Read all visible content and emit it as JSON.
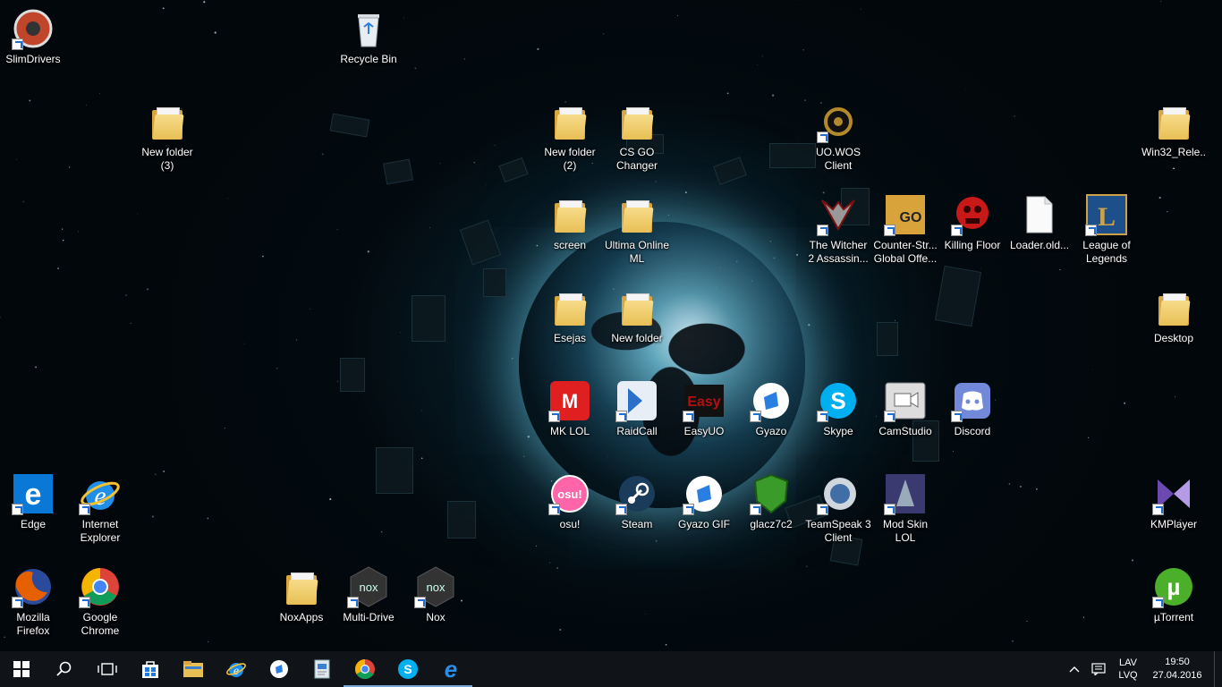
{
  "desktop": {
    "icons": [
      {
        "id": "slimdrivers",
        "label": "SlimDrivers",
        "type": "app",
        "color": "#c0452a",
        "shortcut": true
      },
      {
        "id": "recycle-bin",
        "label": "Recycle Bin",
        "type": "recycle",
        "shortcut": false
      },
      {
        "id": "new-folder-3",
        "label": "New folder (3)",
        "type": "folder",
        "shortcut": false
      },
      {
        "id": "new-folder-2",
        "label": "New folder (2)",
        "type": "folder",
        "shortcut": false
      },
      {
        "id": "cs-go-changer",
        "label": "CS GO Changer",
        "type": "folder",
        "shortcut": false
      },
      {
        "id": "uo-wos-client",
        "label": "UO.WOS Client",
        "type": "app",
        "color": "#b38a2a",
        "shortcut": true
      },
      {
        "id": "win32-release",
        "label": "Win32_Rele...",
        "type": "folder",
        "shortcut": false
      },
      {
        "id": "screen",
        "label": "screen",
        "type": "folder",
        "shortcut": false
      },
      {
        "id": "ultima-online-ml",
        "label": "Ultima Online ML",
        "type": "folder",
        "shortcut": false
      },
      {
        "id": "witcher-2",
        "label": "The Witcher 2 Assassin...",
        "type": "app",
        "color": "#7a1010",
        "shortcut": true
      },
      {
        "id": "counter-strike",
        "label": "Counter-Str... Global Offe...",
        "type": "app",
        "color": "#d7a33a",
        "shortcut": true
      },
      {
        "id": "killing-floor",
        "label": "Killing Floor",
        "type": "app",
        "color": "#c81818",
        "shortcut": true
      },
      {
        "id": "loader-old",
        "label": "Loader.old...",
        "type": "file",
        "shortcut": false
      },
      {
        "id": "league-of-legends",
        "label": "League of Legends",
        "type": "app",
        "color": "#1d4f8a",
        "shortcut": true
      },
      {
        "id": "esejas",
        "label": "Esejas",
        "type": "folder",
        "shortcut": false
      },
      {
        "id": "new-folder",
        "label": "New folder",
        "type": "folder",
        "shortcut": false
      },
      {
        "id": "desktop-folder",
        "label": "Desktop",
        "type": "folder",
        "shortcut": false
      },
      {
        "id": "mk-lol",
        "label": "MK LOL",
        "type": "app",
        "color": "#e02020",
        "shortcut": true
      },
      {
        "id": "raidcall",
        "label": "RaidCall",
        "type": "app",
        "color": "#2a6fc8",
        "shortcut": true
      },
      {
        "id": "easyuo",
        "label": "EasyUO",
        "type": "app",
        "color": "#b01010",
        "shortcut": true
      },
      {
        "id": "gyazo",
        "label": "Gyazo",
        "type": "app",
        "color": "#2a7de1",
        "shortcut": true
      },
      {
        "id": "skype",
        "label": "Skype",
        "type": "app",
        "color": "#00aff0",
        "shortcut": true
      },
      {
        "id": "camstudio",
        "label": "CamStudio",
        "type": "app",
        "color": "#888888",
        "shortcut": true
      },
      {
        "id": "discord",
        "label": "Discord",
        "type": "app",
        "color": "#7289da",
        "shortcut": true
      },
      {
        "id": "edge",
        "label": "Edge",
        "type": "app",
        "color": "#0a78d7",
        "shortcut": true
      },
      {
        "id": "internet-explorer",
        "label": "Internet Explorer",
        "type": "app",
        "color": "#1e8ee8",
        "shortcut": true
      },
      {
        "id": "osu",
        "label": "osu!",
        "type": "app",
        "color": "#ff66aa",
        "shortcut": true
      },
      {
        "id": "steam",
        "label": "Steam",
        "type": "app",
        "color": "#1b3b5a",
        "shortcut": true
      },
      {
        "id": "gyazo-gif",
        "label": "Gyazo GIF",
        "type": "app",
        "color": "#2a7de1",
        "shortcut": true
      },
      {
        "id": "glacz7c2",
        "label": "glacz7c2",
        "type": "app",
        "color": "#3a9a2a",
        "shortcut": true
      },
      {
        "id": "teamspeak-3",
        "label": "TeamSpeak 3 Client",
        "type": "app",
        "color": "#3f6fa5",
        "shortcut": true
      },
      {
        "id": "mod-skin-lol",
        "label": "Mod Skin LOL",
        "type": "app",
        "color": "#3a3a70",
        "shortcut": true
      },
      {
        "id": "kmplayer",
        "label": "KMPlayer",
        "type": "app",
        "color": "#8a6ac8",
        "shortcut": true
      },
      {
        "id": "firefox",
        "label": "Mozilla Firefox",
        "type": "app",
        "color": "#e66000",
        "shortcut": true
      },
      {
        "id": "chrome",
        "label": "Google Chrome",
        "type": "app",
        "color": "#db4437",
        "shortcut": true
      },
      {
        "id": "noxapps",
        "label": "NoxApps",
        "type": "folder",
        "shortcut": false
      },
      {
        "id": "multi-drive",
        "label": "Multi-Drive",
        "type": "app",
        "color": "#333333",
        "shortcut": true
      },
      {
        "id": "nox",
        "label": "Nox",
        "type": "app",
        "color": "#333333",
        "shortcut": true
      },
      {
        "id": "utorrent",
        "label": "µTorrent",
        "type": "app",
        "color": "#4caf2a",
        "shortcut": true
      }
    ]
  },
  "taskbar": {
    "buttons": [
      {
        "id": "start",
        "icon": "windows-logo-icon"
      },
      {
        "id": "search",
        "icon": "search-icon"
      },
      {
        "id": "task-view",
        "icon": "task-view-icon"
      },
      {
        "id": "store",
        "icon": "store-icon"
      },
      {
        "id": "file-explorer",
        "icon": "folder-icon"
      },
      {
        "id": "internet-explorer",
        "icon": "ie-icon"
      },
      {
        "id": "gyazo",
        "icon": "gyazo-icon"
      },
      {
        "id": "unknown-app",
        "icon": "document-icon"
      },
      {
        "id": "chrome",
        "icon": "chrome-icon",
        "active": true
      },
      {
        "id": "skype",
        "icon": "skype-icon",
        "active": true
      },
      {
        "id": "edge",
        "icon": "edge-icon",
        "active": true
      }
    ],
    "tray": {
      "language_line1": "LAV",
      "language_line2": "LVQ",
      "time": "19:50",
      "date": "27.04.2016"
    }
  },
  "colors": {
    "taskbar_bg": "#101419",
    "accent": "#7aa7d6",
    "folder_yellow": "#e8bf55"
  }
}
